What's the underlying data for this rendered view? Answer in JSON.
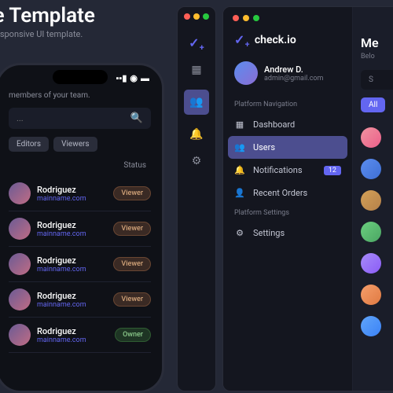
{
  "header": {
    "title": "ive Template",
    "subtitle": "u & responsive UI template."
  },
  "phone": {
    "subtitle": "members of your team.",
    "search_placeholder": "...",
    "chips": [
      "Editors",
      "Viewers"
    ],
    "col_status": "Status",
    "members": [
      {
        "name": "Rodriguez",
        "email": "mainname.com",
        "role": "Viewer"
      },
      {
        "name": "Rodriguez",
        "email": "mainname.com",
        "role": "Viewer"
      },
      {
        "name": "Rodriguez",
        "email": "mainname.com",
        "role": "Viewer"
      },
      {
        "name": "Rodriguez",
        "email": "mainname.com",
        "role": "Viewer"
      },
      {
        "name": "Rodriguez",
        "email": "mainname.com",
        "role": "Owner"
      }
    ]
  },
  "win2": {
    "brand": "check.io",
    "profile": {
      "name": "Andrew D.",
      "email": "admin@gmail.com"
    },
    "nav": {
      "section1": "Platform Navigation",
      "items1": [
        {
          "icon": "dashboard",
          "label": "Dashboard"
        },
        {
          "icon": "users",
          "label": "Users"
        },
        {
          "icon": "bell",
          "label": "Notifications",
          "count": "12"
        },
        {
          "icon": "orders",
          "label": "Recent Orders"
        }
      ],
      "section2": "Platform Settings",
      "items2": [
        {
          "icon": "gear",
          "label": "Settings"
        }
      ]
    },
    "right": {
      "title": "Me",
      "subtitle": "Belo",
      "search": "S",
      "tabs": [
        "All"
      ]
    }
  }
}
